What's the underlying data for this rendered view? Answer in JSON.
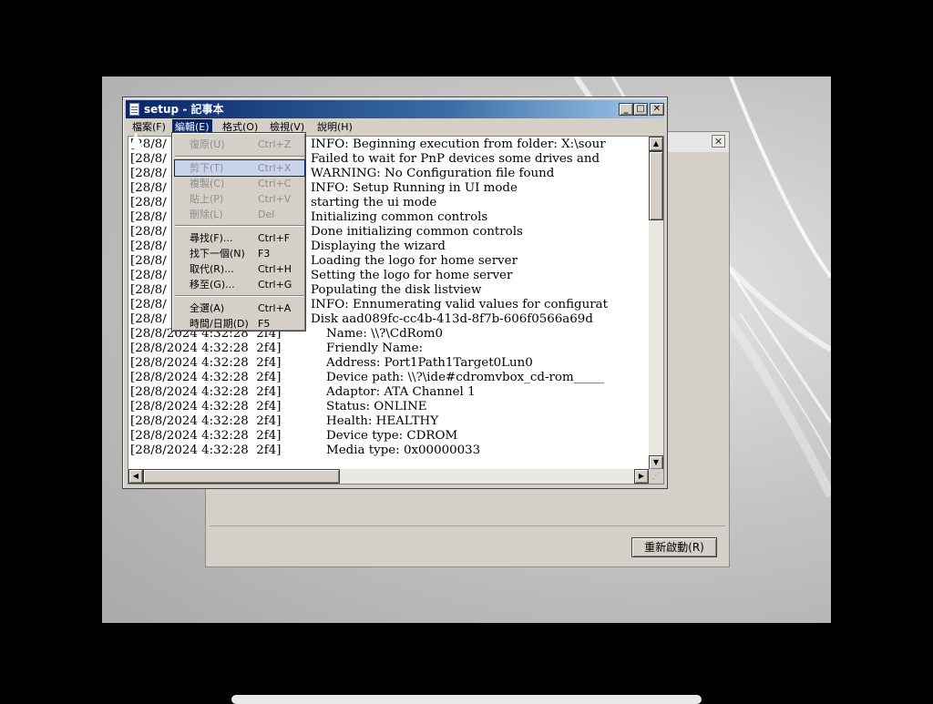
{
  "notepad": {
    "title": "setup - 記事本",
    "menu": [
      "檔案(F)",
      "編輯(E)",
      "格式(O)",
      "檢視(V)",
      "說明(H)"
    ],
    "edit_menu": {
      "undo": {
        "label": "復原(U)",
        "key": "Ctrl+Z"
      },
      "cut": {
        "label": "剪下(T)",
        "key": "Ctrl+X"
      },
      "copy": {
        "label": "複製(C)",
        "key": "Ctrl+C"
      },
      "paste": {
        "label": "貼上(P)",
        "key": "Ctrl+V"
      },
      "delete": {
        "label": "刪除(L)",
        "key": "Del"
      },
      "find": {
        "label": "尋找(F)...",
        "key": "Ctrl+F"
      },
      "find_next": {
        "label": "找下一個(N)",
        "key": "F3"
      },
      "replace": {
        "label": "取代(R)...",
        "key": "Ctrl+H"
      },
      "goto": {
        "label": "移至(G)...",
        "key": "Ctrl+G"
      },
      "select_all": {
        "label": "全選(A)",
        "key": "Ctrl+A"
      },
      "time_date": {
        "label": "時間/日期(D)",
        "key": "F5"
      }
    },
    "log_lines": [
      {
        "ts": "[28/8/",
        "msg": "INFO: Beginning execution from folder: X:\\sour"
      },
      {
        "ts": "[28/8/",
        "msg": "Failed to wait for PnP devices some drives and"
      },
      {
        "ts": "[28/8/",
        "msg": "WARNING: No Configuration file found"
      },
      {
        "ts": "[28/8/",
        "msg": "INFO: Setup Running in UI mode"
      },
      {
        "ts": "[28/8/",
        "msg": "starting the ui mode"
      },
      {
        "ts": "[28/8/",
        "msg": "Initializing common controls"
      },
      {
        "ts": "[28/8/",
        "msg": "Done initializing common controls"
      },
      {
        "ts": "[28/8/",
        "msg": "Displaying the wizard"
      },
      {
        "ts": "[28/8/",
        "msg": "Loading the logo for home server"
      },
      {
        "ts": "[28/8/",
        "msg": "Setting the logo for home server"
      },
      {
        "ts": "[28/8/",
        "msg": "Populating the disk listview"
      },
      {
        "ts": "[28/8/",
        "msg": "INFO: Ennumerating valid values for configurat"
      },
      {
        "ts": "[28/8/",
        "msg": "Disk aad089fc-cc4b-413d-8f7b-606f0566a69d"
      },
      {
        "ts": "[28/8/2024 4:32:28  2f4]",
        "msg": "    Name: \\\\?\\CdRom0"
      },
      {
        "ts": "[28/8/2024 4:32:28  2f4]",
        "msg": "    Friendly Name:"
      },
      {
        "ts": "[28/8/2024 4:32:28  2f4]",
        "msg": "    Address: Port1Path1Target0Lun0"
      },
      {
        "ts": "[28/8/2024 4:32:28  2f4]",
        "msg": "    Device path: \\\\?\\ide#cdromvbox_cd-rom_____"
      },
      {
        "ts": "[28/8/2024 4:32:28  2f4]",
        "msg": "    Adaptor: ATA Channel 1"
      },
      {
        "ts": "[28/8/2024 4:32:28  2f4]",
        "msg": "    Status: ONLINE"
      },
      {
        "ts": "[28/8/2024 4:32:28  2f4]",
        "msg": "    Health: HEALTHY"
      },
      {
        "ts": "[28/8/2024 4:32:28  2f4]",
        "msg": "    Device type: CDROM"
      },
      {
        "ts": "[28/8/2024 4:32:28  2f4]",
        "msg": "    Media type: 0x00000033"
      }
    ]
  },
  "setup_dialog": {
    "reboot_label": "重新啟動(R)"
  }
}
